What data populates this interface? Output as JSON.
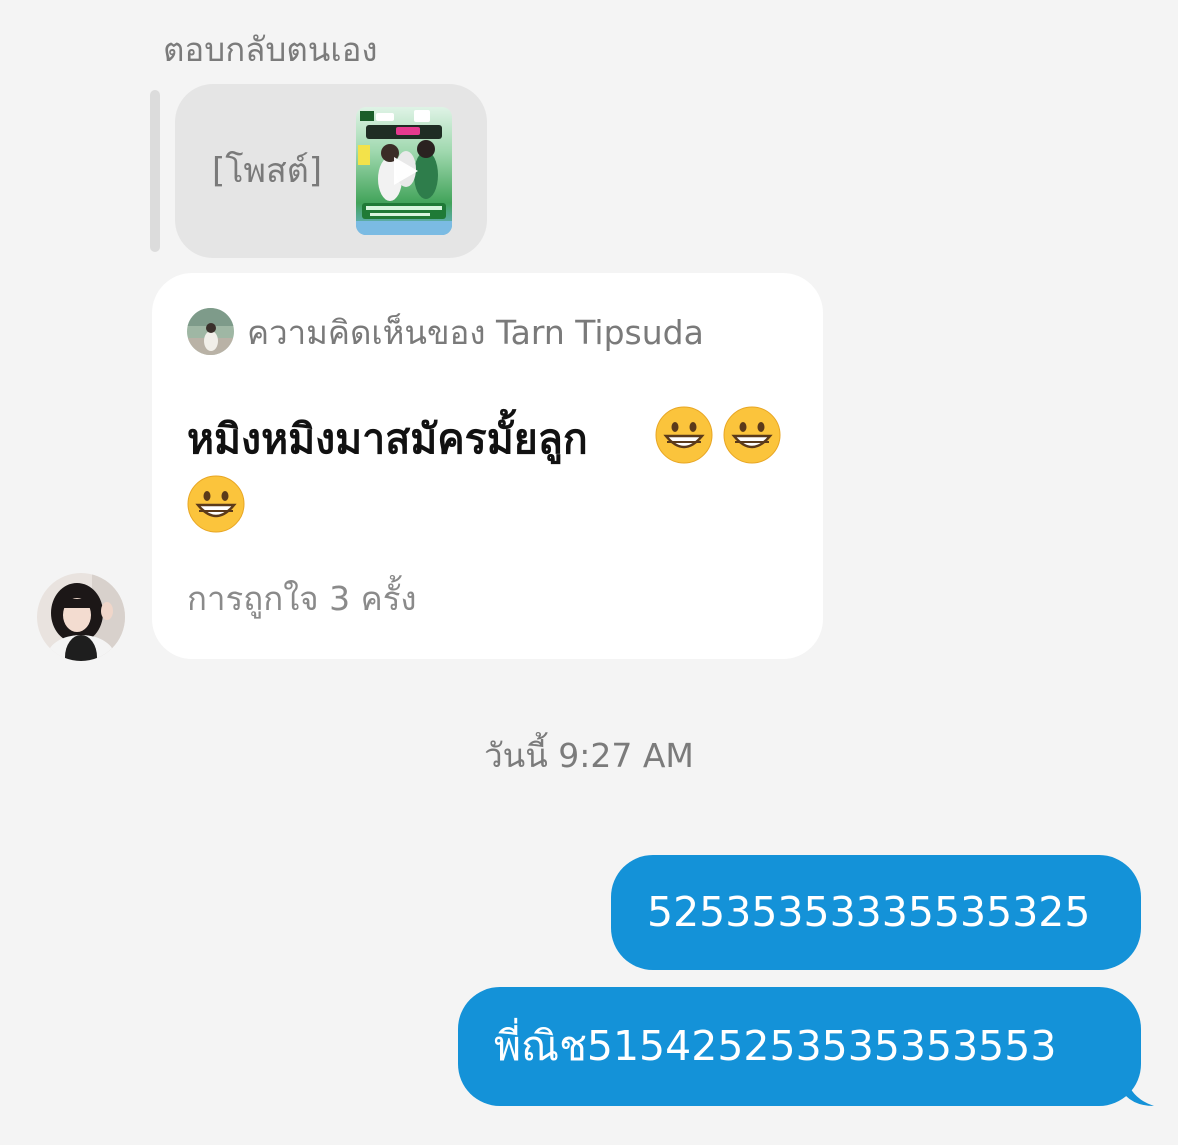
{
  "reply_label": "ตอบกลับตนเอง",
  "quoted_post": {
    "label": "[โพสต์]",
    "thumbnail": "video-post-thumbnail",
    "play_icon": "play-icon"
  },
  "comment": {
    "header": "ความคิดเห็นของ Tarn Tipsuda",
    "body": "หมิงหมิงมาสมัครมั้ยลูก",
    "emojis": [
      "grinning-face-emoji",
      "grinning-face-emoji",
      "grinning-face-emoji"
    ],
    "likes": "การถูกใจ 3 ครั้ง"
  },
  "timestamp": "วันนี้ 9:27 AM",
  "sent_messages": [
    {
      "text": "52535353335535325"
    },
    {
      "text": "พี่ณิช515425253535353553"
    }
  ],
  "colors": {
    "background": "#f4f4f4",
    "sent_bubble": "#1492d8",
    "quote_bubble": "#e5e5e5",
    "card": "#ffffff"
  }
}
